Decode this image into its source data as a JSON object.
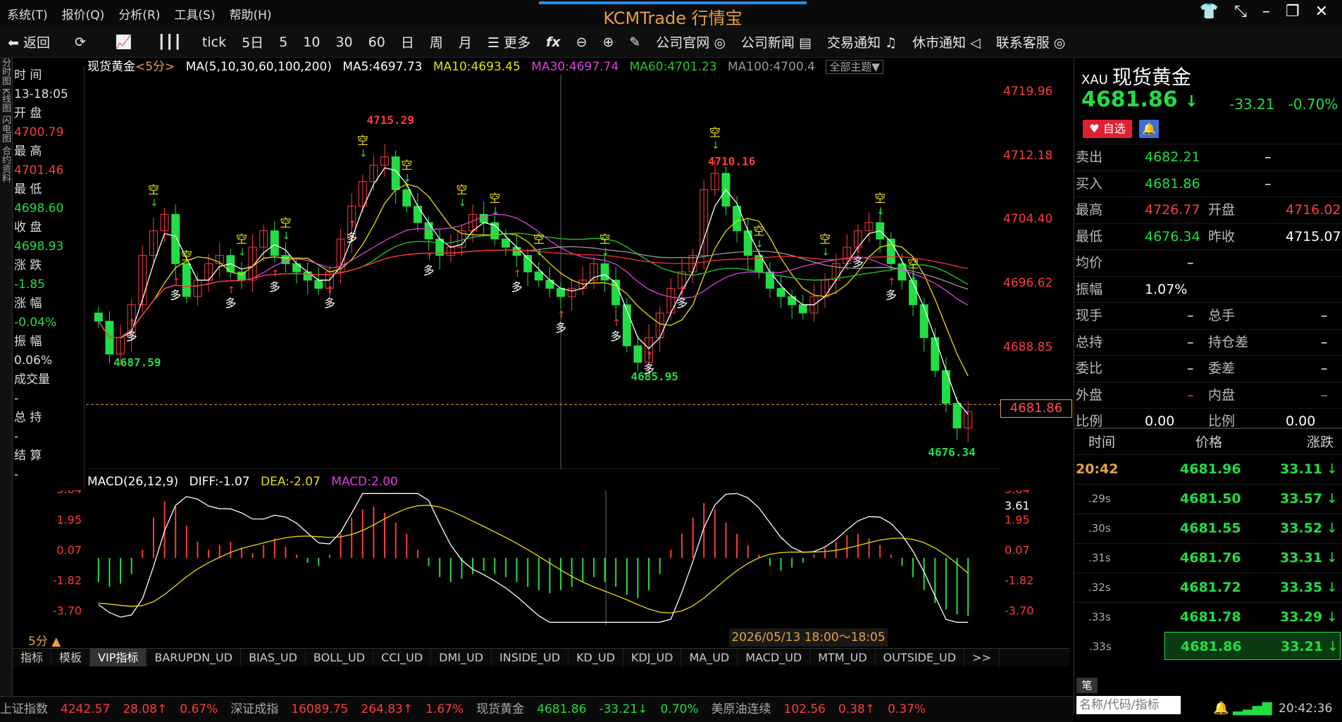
{
  "menu": [
    "系统(T)",
    "报价(Q)",
    "分析(R)",
    "工具(S)",
    "帮助(H)"
  ],
  "brand": "KCMTrade 行情宝",
  "toolbar": {
    "back": "返回",
    "items": [
      "tick",
      "5日",
      "5",
      "10",
      "30",
      "60",
      "日",
      "周",
      "月"
    ],
    "more": "更多",
    "links": [
      "公司官网",
      "公司新闻",
      "交易通知",
      "休市通知",
      "联系客服"
    ]
  },
  "left_strip": "分时图 K线图 闪电图 合约资料",
  "info_panel": [
    {
      "label": "时 间",
      "value": "13-18:05"
    },
    {
      "label": "开 盘",
      "value": "4700.79",
      "color": "red"
    },
    {
      "label": "最 高",
      "value": "4701.46",
      "color": "red"
    },
    {
      "label": "最 低",
      "value": "4698.60",
      "color": "grn"
    },
    {
      "label": "收 盘",
      "value": "4698.93",
      "color": "grn"
    },
    {
      "label": "涨 跌",
      "value": "-1.85",
      "color": "grn"
    },
    {
      "label": "涨 幅",
      "value": "-0.04%",
      "color": "grn"
    },
    {
      "label": "振 幅",
      "value": "0.06%"
    },
    {
      "label": "成交量",
      "value": "-"
    },
    {
      "label": "总 持",
      "value": "-"
    },
    {
      "label": "结 算",
      "value": "-"
    }
  ],
  "legend": {
    "symbol": "现货黄金",
    "period": "<5分>",
    "ma_params": "MA(5,10,30,60,100,200)",
    "ma5": "MA5:4697.73",
    "ma10": "MA10:4693.45",
    "ma30": "MA30:4697.74",
    "ma60": "MA60:4701.23",
    "ma100": "MA100:4700.4",
    "theme": "全部主题▼"
  },
  "price_axis": [
    "4719.96",
    "4712.18",
    "4704.40",
    "4696.62",
    "4688.85"
  ],
  "current_price_tag": "4681.86",
  "annotations": {
    "high1": "4715.29",
    "high2": "4710.16",
    "low1": "4687.59",
    "low2": "4685.95",
    "low3": "4676.34",
    "sell": "空",
    "buy": "多"
  },
  "macd": {
    "label": "MACD(26,12,9)",
    "diff": "DIFF:-1.07",
    "dea": "DEA:-2.07",
    "macd": "MACD:2.00",
    "axis_left": [
      "3.84",
      "1.95",
      "0.07",
      "-1.82",
      "-3.70"
    ],
    "axis_right": [
      "3.84",
      "1.95",
      "0.07",
      "-1.82",
      "-3.70"
    ],
    "cursor_value": "3.61"
  },
  "chart_data": {
    "type": "candlestick",
    "title": "现货黄金 <5分>",
    "ylim": [
      4674,
      4722
    ],
    "closes": [
      4692,
      4688,
      4690,
      4694,
      4700,
      4703,
      4705,
      4699,
      4695,
      4697,
      4699,
      4700,
      4698,
      4697,
      4701,
      4703,
      4700,
      4699,
      4698,
      4697,
      4696,
      4698,
      4702,
      4706,
      4709,
      4711,
      4712,
      4708,
      4706,
      4704,
      4702,
      4700,
      4701,
      4703,
      4705,
      4704,
      4702,
      4701,
      4700,
      4698,
      4697,
      4696,
      4695,
      4696,
      4697,
      4699,
      4697,
      4694,
      4689,
      4687,
      4690,
      4693,
      4696,
      4698,
      4700,
      4708,
      4710,
      4706,
      4703,
      4700,
      4698,
      4696,
      4695,
      4694,
      4693,
      4695,
      4697,
      4699,
      4701,
      4703,
      4704,
      4702,
      4699,
      4697,
      4694,
      4690,
      4686,
      4682,
      4679,
      4681
    ],
    "macd_hist": [
      -1.5,
      -1.8,
      -1.6,
      -1.0,
      0.5,
      2.5,
      3.5,
      3.2,
      2.0,
      1.0,
      0.5,
      0.8,
      1.0,
      0.6,
      0.3,
      0.8,
      1.2,
      0.7,
      0.2,
      -0.3,
      -0.5,
      0.2,
      1.5,
      2.5,
      3.0,
      3.2,
      2.8,
      2.2,
      1.5,
      0.5,
      -0.5,
      -1.2,
      -1.5,
      -1.3,
      -1.0,
      -0.8,
      -1.0,
      -1.2,
      -1.5,
      -1.8,
      -2.0,
      -2.2,
      -2.0,
      -1.8,
      -1.5,
      -1.2,
      -1.5,
      -1.8,
      -2.3,
      -2.5,
      -2.0,
      -1.0,
      0.5,
      1.5,
      2.5,
      3.4,
      3.0,
      2.2,
      1.5,
      0.8,
      0.2,
      -0.5,
      -0.8,
      -0.6,
      -0.3,
      0.2,
      0.6,
      1.0,
      1.4,
      1.5,
      1.2,
      0.8,
      0.2,
      -0.5,
      -1.2,
      -2.0,
      -2.8,
      -3.2,
      -3.5,
      -3.6
    ],
    "current": 4681.86
  },
  "date_range": "2026/05/13 18:00～18:05 三",
  "period_label": "5分 ▲",
  "tabs": [
    "指标",
    "模板",
    "VIP指标",
    "BARUPDN_UD",
    "BIAS_UD",
    "BOLL_UD",
    "CCI_UD",
    "DMI_UD",
    "INSIDE_UD",
    "KD_UD",
    "KDJ_UD",
    "MA_UD",
    "MACD_UD",
    "MTM_UD",
    "OUTSIDE_UD",
    ">>"
  ],
  "quote": {
    "code": "XAU",
    "name": "现货黄金",
    "price": "4681.86",
    "arrow": "↓",
    "change": "-33.21",
    "pct": "-0.70%",
    "watch": "自选",
    "rows": [
      {
        "l1": "卖出",
        "v1": "4682.21",
        "c1": "grn",
        "l2": "",
        "v2": "–"
      },
      {
        "l1": "买入",
        "v1": "4681.86",
        "c1": "grn",
        "l2": "",
        "v2": "–"
      },
      {
        "l1": "最高",
        "v1": "4726.77",
        "c1": "red",
        "l2": "开盘",
        "v2": "4716.02",
        "c2": "red"
      },
      {
        "l1": "最低",
        "v1": "4676.34",
        "c1": "grn",
        "l2": "昨收",
        "v2": "4715.07",
        "c2": "wht"
      },
      {
        "l1": "均价",
        "v1": "–",
        "c1": "wht",
        "l2": "",
        "v2": ""
      },
      {
        "l1": "振幅",
        "v1": "1.07%",
        "c1": "wht",
        "l2": "",
        "v2": ""
      },
      {
        "l1": "现手",
        "v1": "–",
        "c1": "wht",
        "l2": "总手",
        "v2": "–"
      },
      {
        "l1": "总持",
        "v1": "–",
        "c1": "wht",
        "l2": "持仓差",
        "v2": "–"
      },
      {
        "l1": "委比",
        "v1": "–",
        "c1": "wht",
        "l2": "委差",
        "v2": "–"
      },
      {
        "l1": "外盘",
        "v1": "–",
        "c1": "red",
        "l2": "内盘",
        "v2": "–",
        "c2": "grn"
      },
      {
        "l1": "比例",
        "v1": "0.00",
        "c1": "wht",
        "l2": "比例",
        "v2": "0.00",
        "c2": "wht"
      }
    ],
    "tick_header": [
      "时间",
      "价格",
      "涨跌"
    ],
    "ticks": [
      {
        "t": "20:42",
        "p": "4681.96",
        "c": "33.11"
      },
      {
        "t": ".29s",
        "p": "4681.50",
        "c": "33.57"
      },
      {
        "t": ".30s",
        "p": "4681.55",
        "c": "33.52"
      },
      {
        "t": ".31s",
        "p": "4681.76",
        "c": "33.31"
      },
      {
        "t": ".32s",
        "p": "4681.72",
        "c": "33.35"
      },
      {
        "t": ".33s",
        "p": "4681.78",
        "c": "33.29"
      },
      {
        "t": ".33s",
        "p": "4681.86",
        "c": "33.21"
      }
    ]
  },
  "bi_label": "笔",
  "search_placeholder": "名称/代码/指标",
  "statusbar": [
    {
      "name": "上证指数",
      "v": "4242.57",
      "d": "28.08↑",
      "p": "0.67%",
      "c": "red"
    },
    {
      "name": "深证成指",
      "v": "16089.75",
      "d": "264.83↑",
      "p": "1.67%",
      "c": "red"
    },
    {
      "name": "现货黄金",
      "v": "4681.86",
      "d": "-33.21↓",
      "p": "0.70%",
      "c": "grn"
    },
    {
      "name": "美原油连续",
      "v": "102.56",
      "d": "0.38↑",
      "p": "0.37%",
      "c": "red"
    }
  ],
  "clock": "20:42:36",
  "colors": {
    "up": "#ff3b3b",
    "down": "#22dd44",
    "ma5": "#ffffff",
    "ma10": "#e8e000",
    "ma30": "#e040e0",
    "ma60": "#22cc22",
    "ma100": "#999999",
    "ma200": "#ff3030"
  }
}
